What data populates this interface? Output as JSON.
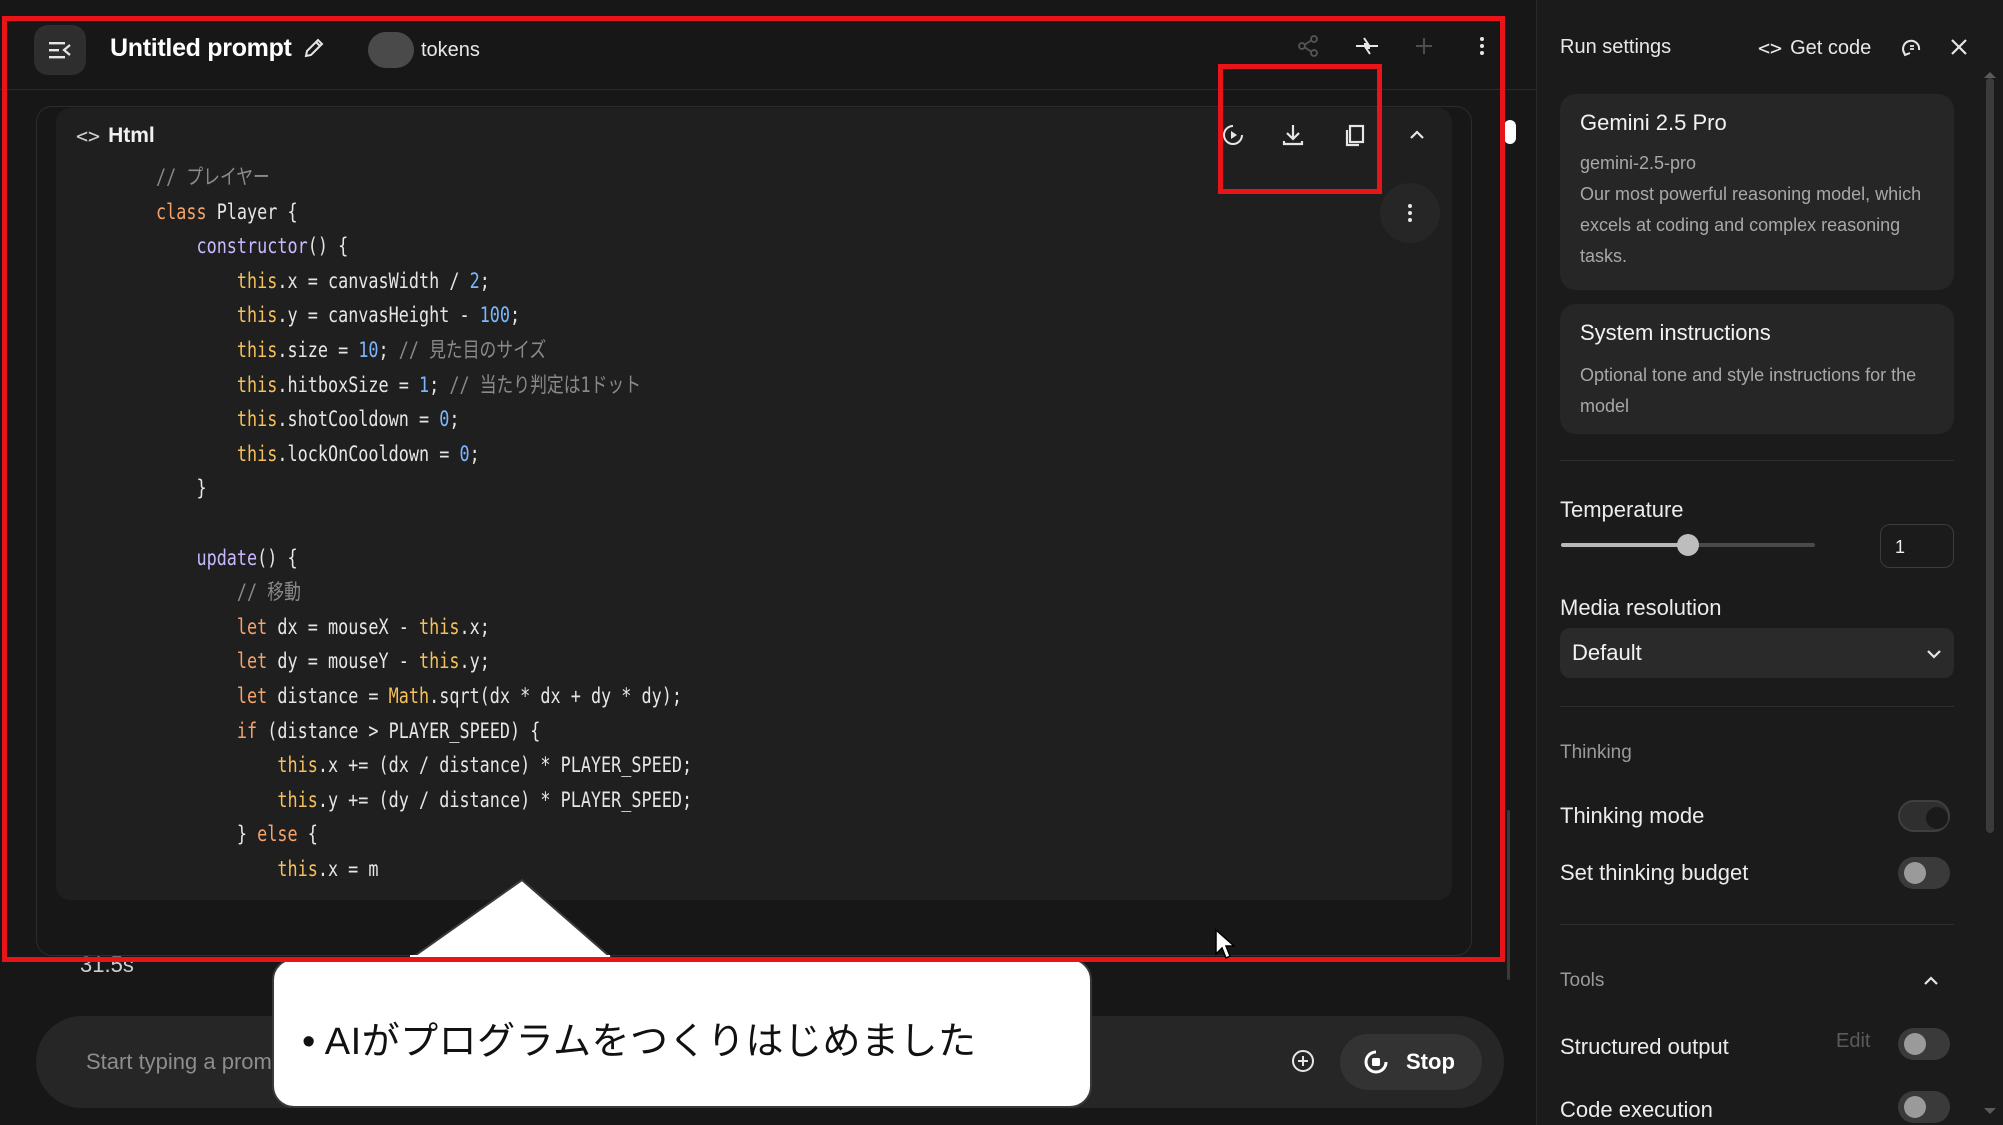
{
  "header": {
    "title": "Untitled prompt",
    "tokens_label": "tokens"
  },
  "code_block": {
    "language": "Html",
    "lines": [
      {
        "indent": 0,
        "parts": [
          {
            "t": "// プレイヤー",
            "c": "com"
          }
        ]
      },
      {
        "indent": 0,
        "parts": [
          {
            "t": "class ",
            "c": "kw"
          },
          {
            "t": "Player",
            "c": "op"
          },
          {
            "t": " {",
            "c": "op"
          }
        ]
      },
      {
        "indent": 1,
        "parts": [
          {
            "t": "constructor",
            "c": "fn"
          },
          {
            "t": "() {",
            "c": "op"
          }
        ]
      },
      {
        "indent": 2,
        "parts": [
          {
            "t": "this",
            "c": "this"
          },
          {
            "t": ".x = canvasWidth / ",
            "c": "op"
          },
          {
            "t": "2",
            "c": "num"
          },
          {
            "t": ";",
            "c": "op"
          }
        ]
      },
      {
        "indent": 2,
        "parts": [
          {
            "t": "this",
            "c": "this"
          },
          {
            "t": ".y = canvasHeight - ",
            "c": "op"
          },
          {
            "t": "100",
            "c": "num"
          },
          {
            "t": ";",
            "c": "op"
          }
        ]
      },
      {
        "indent": 2,
        "parts": [
          {
            "t": "this",
            "c": "this"
          },
          {
            "t": ".size = ",
            "c": "op"
          },
          {
            "t": "10",
            "c": "num"
          },
          {
            "t": "; ",
            "c": "op"
          },
          {
            "t": "// 見た目のサイズ",
            "c": "com"
          }
        ]
      },
      {
        "indent": 2,
        "parts": [
          {
            "t": "this",
            "c": "this"
          },
          {
            "t": ".hitboxSize = ",
            "c": "op"
          },
          {
            "t": "1",
            "c": "num"
          },
          {
            "t": "; ",
            "c": "op"
          },
          {
            "t": "// 当たり判定は1ドット",
            "c": "com"
          }
        ]
      },
      {
        "indent": 2,
        "parts": [
          {
            "t": "this",
            "c": "this"
          },
          {
            "t": ".shotCooldown = ",
            "c": "op"
          },
          {
            "t": "0",
            "c": "num"
          },
          {
            "t": ";",
            "c": "op"
          }
        ]
      },
      {
        "indent": 2,
        "parts": [
          {
            "t": "this",
            "c": "this"
          },
          {
            "t": ".lockOnCooldown = ",
            "c": "op"
          },
          {
            "t": "0",
            "c": "num"
          },
          {
            "t": ";",
            "c": "op"
          }
        ]
      },
      {
        "indent": 1,
        "parts": [
          {
            "t": "}",
            "c": "op"
          }
        ]
      },
      {
        "indent": 0,
        "parts": []
      },
      {
        "indent": 1,
        "parts": [
          {
            "t": "update",
            "c": "fn"
          },
          {
            "t": "() {",
            "c": "op"
          }
        ]
      },
      {
        "indent": 2,
        "parts": [
          {
            "t": "// 移動",
            "c": "com"
          }
        ]
      },
      {
        "indent": 2,
        "parts": [
          {
            "t": "let",
            "c": "kw"
          },
          {
            "t": " dx = mouseX - ",
            "c": "op"
          },
          {
            "t": "this",
            "c": "this"
          },
          {
            "t": ".x;",
            "c": "op"
          }
        ]
      },
      {
        "indent": 2,
        "parts": [
          {
            "t": "let",
            "c": "kw"
          },
          {
            "t": " dy = mouseY - ",
            "c": "op"
          },
          {
            "t": "this",
            "c": "this"
          },
          {
            "t": ".y;",
            "c": "op"
          }
        ]
      },
      {
        "indent": 2,
        "parts": [
          {
            "t": "let",
            "c": "kw"
          },
          {
            "t": " distance = ",
            "c": "op"
          },
          {
            "t": "Math",
            "c": "this"
          },
          {
            "t": ".sqrt(dx * dx + dy * dy);",
            "c": "op"
          }
        ]
      },
      {
        "indent": 2,
        "parts": [
          {
            "t": "if",
            "c": "kw"
          },
          {
            "t": " (distance > PLAYER_SPEED) {",
            "c": "op"
          }
        ]
      },
      {
        "indent": 3,
        "parts": [
          {
            "t": "this",
            "c": "this"
          },
          {
            "t": ".x += (dx / distance) * PLAYER_SPEED;",
            "c": "op"
          }
        ]
      },
      {
        "indent": 3,
        "parts": [
          {
            "t": "this",
            "c": "this"
          },
          {
            "t": ".y += (dy / distance) * PLAYER_SPEED;",
            "c": "op"
          }
        ]
      },
      {
        "indent": 2,
        "parts": [
          {
            "t": "} ",
            "c": "op"
          },
          {
            "t": "else",
            "c": "kw"
          },
          {
            "t": " {",
            "c": "op"
          }
        ]
      },
      {
        "indent": 3,
        "parts": [
          {
            "t": "this",
            "c": "this"
          },
          {
            "t": ".x = m",
            "c": "op"
          }
        ]
      }
    ]
  },
  "elapsed": "31.5s",
  "input": {
    "placeholder": "Start typing a prompt",
    "stop_label": "Stop"
  },
  "callout": {
    "text": "• AIがプログラムをつくりはじめました"
  },
  "run_settings": {
    "title": "Run settings",
    "get_code_label": "Get code",
    "model": {
      "name": "Gemini 2.5 Pro",
      "id": "gemini-2.5-pro",
      "description": "Our most powerful reasoning model, which excels at coding and complex reasoning tasks."
    },
    "system_instructions": {
      "title": "System instructions",
      "placeholder": "Optional tone and style instructions for the model"
    },
    "temperature": {
      "label": "Temperature",
      "value": "1",
      "slider_fraction": 0.5
    },
    "media_resolution": {
      "label": "Media resolution",
      "selected": "Default"
    },
    "thinking": {
      "section": "Thinking",
      "mode_label": "Thinking mode",
      "mode_on": true,
      "budget_label": "Set thinking budget",
      "budget_on": false
    },
    "tools": {
      "section": "Tools",
      "structured_output_label": "Structured output",
      "edit_label": "Edit",
      "code_execution_label": "Code execution"
    }
  },
  "colors": {
    "highlight_red": "#e8141a",
    "background": "#171717",
    "panel": "#1b1b1b"
  }
}
